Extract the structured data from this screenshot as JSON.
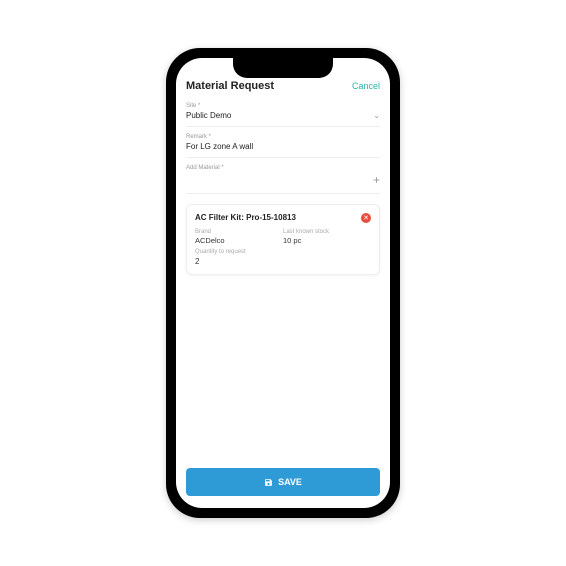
{
  "header": {
    "title": "Material Request",
    "cancel": "Cancel"
  },
  "site": {
    "label": "Site *",
    "value": "Public Demo"
  },
  "remark": {
    "label": "Remark *",
    "value": "For LG zone A wall"
  },
  "addMaterial": {
    "label": "Add Material *"
  },
  "item": {
    "title": "AC Filter Kit: Pro-15-10813",
    "brandLabel": "Brand",
    "brandValue": "ACDelco",
    "stockLabel": "Last known stock",
    "stockValue": "10 pc",
    "qtyLabel": "Quantity to request",
    "qtyValue": "2"
  },
  "save": {
    "label": "SAVE"
  }
}
